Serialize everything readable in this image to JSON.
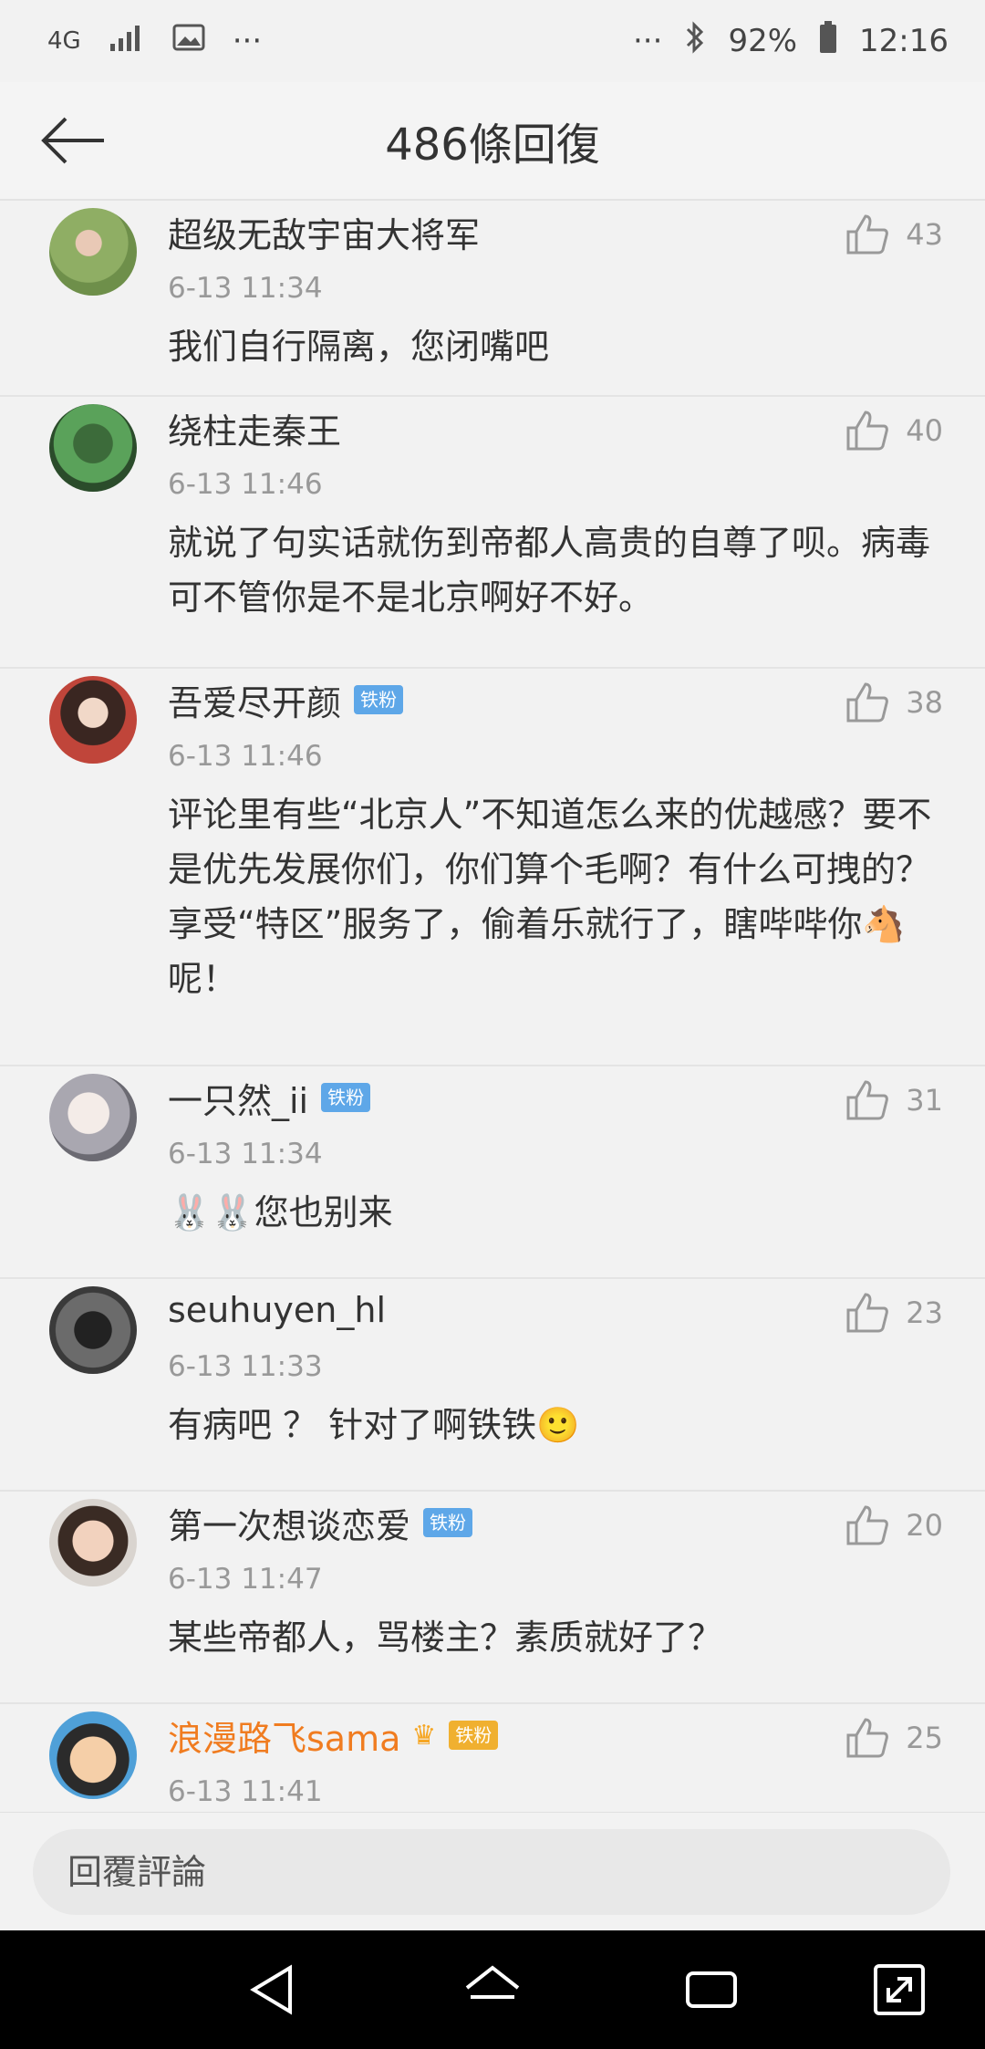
{
  "status_bar": {
    "network": "4G",
    "overflow": "···",
    "right_overflow": "···",
    "battery": "92%",
    "time": "12:16"
  },
  "header": {
    "title": "486條回復"
  },
  "comments": [
    {
      "name": "超级无敌宇宙大将军",
      "badge": "",
      "time": "6-13 11:34",
      "likes": "43",
      "text": "我们自行隔离，您闭嘴吧"
    },
    {
      "name": "绕柱走秦王",
      "badge": "",
      "time": "6-13 11:46",
      "likes": "40",
      "text": "就说了句实话就伤到帝都人高贵的自尊了呗。病毒可不管你是不是北京啊好不好。"
    },
    {
      "name": "吾爱尽开颜",
      "badge": "铁粉",
      "time": "6-13 11:46",
      "likes": "38",
      "text": "评论里有些“北京人”不知道怎么来的优越感？要不是优先发展你们，你们算个毛啊？有什么可拽的？享受“特区”服务了，偷着乐就行了，瞎哔哔你🐴 呢！"
    },
    {
      "name": "一只然_ii",
      "badge": "铁粉",
      "time": "6-13 11:34",
      "likes": "31",
      "text": "🐰🐰您也别来"
    },
    {
      "name": "seuhuyen_hl",
      "badge": "",
      "time": "6-13 11:33",
      "likes": "23",
      "text": "有病吧 ？ 针对了啊铁铁🙂"
    },
    {
      "name": "第一次想谈恋爱",
      "badge": "铁粉",
      "time": "6-13 11:47",
      "likes": "20",
      "text": "某些帝都人，骂楼主？素质就好了？"
    },
    {
      "name": "浪漫路飞sama",
      "badge": "铁粉",
      "time": "6-13 11:41",
      "likes": "25",
      "text": ""
    }
  ],
  "reply": {
    "placeholder": "回覆評論"
  },
  "colors": {
    "badge_blue": "#5ea7e8",
    "vip_orange": "#f07c20",
    "background": "#f2f2f2"
  }
}
